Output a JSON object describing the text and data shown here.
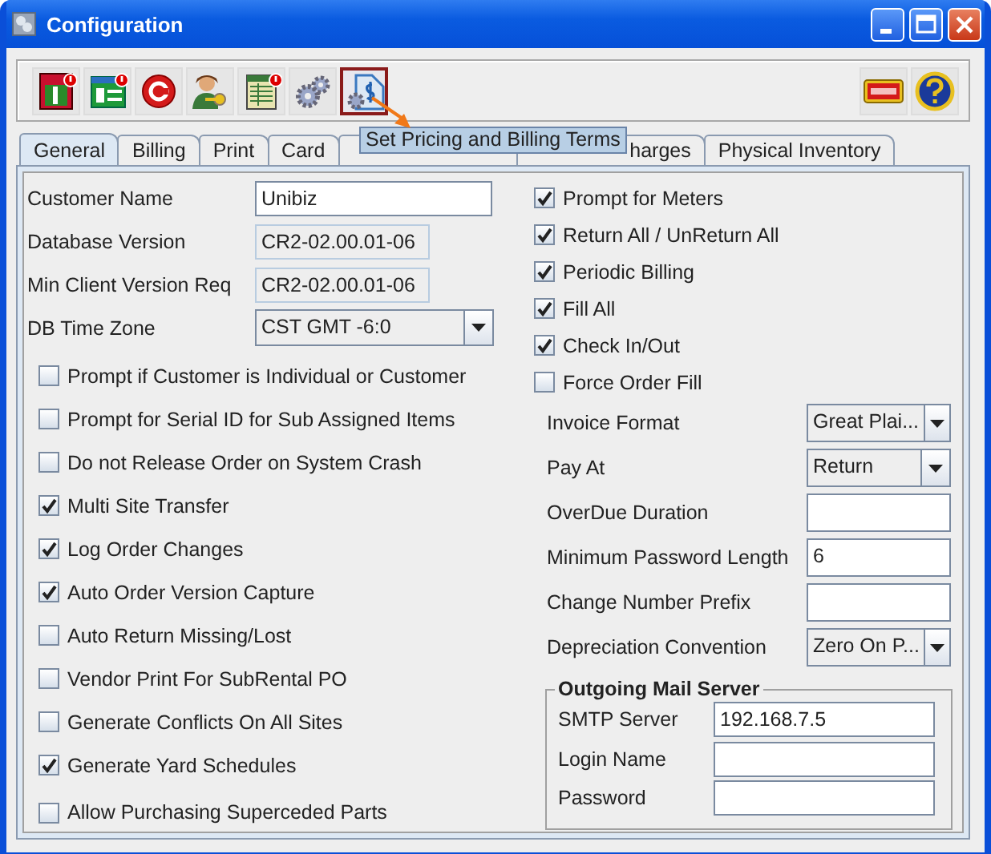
{
  "window": {
    "title": "Configuration"
  },
  "toolbar": {
    "left": [
      {
        "kind": "pay",
        "selected": false
      },
      {
        "kind": "invoice",
        "selected": false
      },
      {
        "kind": "circle",
        "selected": false
      },
      {
        "kind": "user-key",
        "selected": false
      },
      {
        "kind": "ledger",
        "selected": false
      },
      {
        "kind": "gears",
        "selected": false
      },
      {
        "kind": "price-tag",
        "selected": true
      }
    ],
    "right": [
      {
        "kind": "exit"
      },
      {
        "kind": "help"
      }
    ]
  },
  "tooltip": {
    "text": "Set Pricing and Billing Terms"
  },
  "tabs": [
    {
      "label": "General",
      "selected": true
    },
    {
      "label": "Billing",
      "selected": false
    },
    {
      "label": "Print",
      "selected": false
    },
    {
      "label": "Card",
      "selected": false
    },
    {
      "selected": false,
      "covered": true
    },
    {
      "label": "harges",
      "selected": false,
      "covered": true
    },
    {
      "label": "Physical Inventory",
      "selected": false
    }
  ],
  "general": {
    "fields": [
      {
        "kind": "text",
        "label": "Customer Name",
        "value": "Unibiz"
      },
      {
        "kind": "readonly",
        "label": "Database Version",
        "value": "CR2-02.00.01-06"
      },
      {
        "kind": "readonly",
        "label": "Min Client Version Req",
        "value": "CR2-02.00.01-06"
      },
      {
        "kind": "combo",
        "label": "DB Time Zone",
        "value": "CST GMT -6:0"
      }
    ],
    "options_left": [
      {
        "label": "Prompt if Customer is Individual or Customer",
        "checked": false
      },
      {
        "label": "Prompt for Serial ID for Sub Assigned Items",
        "checked": false
      },
      {
        "label": "Do not Release Order on System Crash",
        "checked": false
      },
      {
        "label": "Multi Site Transfer",
        "checked": true
      },
      {
        "label": "Log Order Changes",
        "checked": true
      },
      {
        "label": "Auto Order Version Capture",
        "checked": true
      },
      {
        "label": "Auto Return Missing/Lost",
        "checked": false
      },
      {
        "label": "Vendor Print For SubRental PO",
        "checked": false
      },
      {
        "label": "Generate Conflicts On All Sites",
        "checked": false
      },
      {
        "label": "Generate Yard Schedules",
        "checked": true
      },
      {
        "label": "Allow Purchasing Superceded Parts",
        "checked": false
      }
    ],
    "options_right": [
      {
        "label": "Prompt for Meters",
        "checked": true
      },
      {
        "label": "Return All / UnReturn All",
        "checked": true
      },
      {
        "label": "Periodic Billing",
        "checked": true
      },
      {
        "label": "Fill All",
        "checked": true
      },
      {
        "label": "Check In/Out",
        "checked": true
      },
      {
        "label": "Force Order Fill",
        "checked": false
      }
    ],
    "settings": [
      {
        "kind": "combo",
        "label": "Invoice Format",
        "value": "Great Plai..."
      },
      {
        "kind": "combo",
        "label": "Pay At",
        "value": "Return"
      },
      {
        "kind": "text",
        "label": "OverDue Duration"
      },
      {
        "kind": "text",
        "label": "Minimum Password Length",
        "value": "6"
      },
      {
        "kind": "text",
        "label": "Change Number Prefix"
      },
      {
        "kind": "combo",
        "label": "Depreciation Convention",
        "value": "Zero On P..."
      }
    ],
    "mail_server": {
      "title": "Outgoing Mail Server",
      "fields": [
        {
          "label": "SMTP Server",
          "value": "192.168.7.5"
        },
        {
          "label": "Login Name"
        },
        {
          "label": "Password"
        }
      ]
    }
  }
}
